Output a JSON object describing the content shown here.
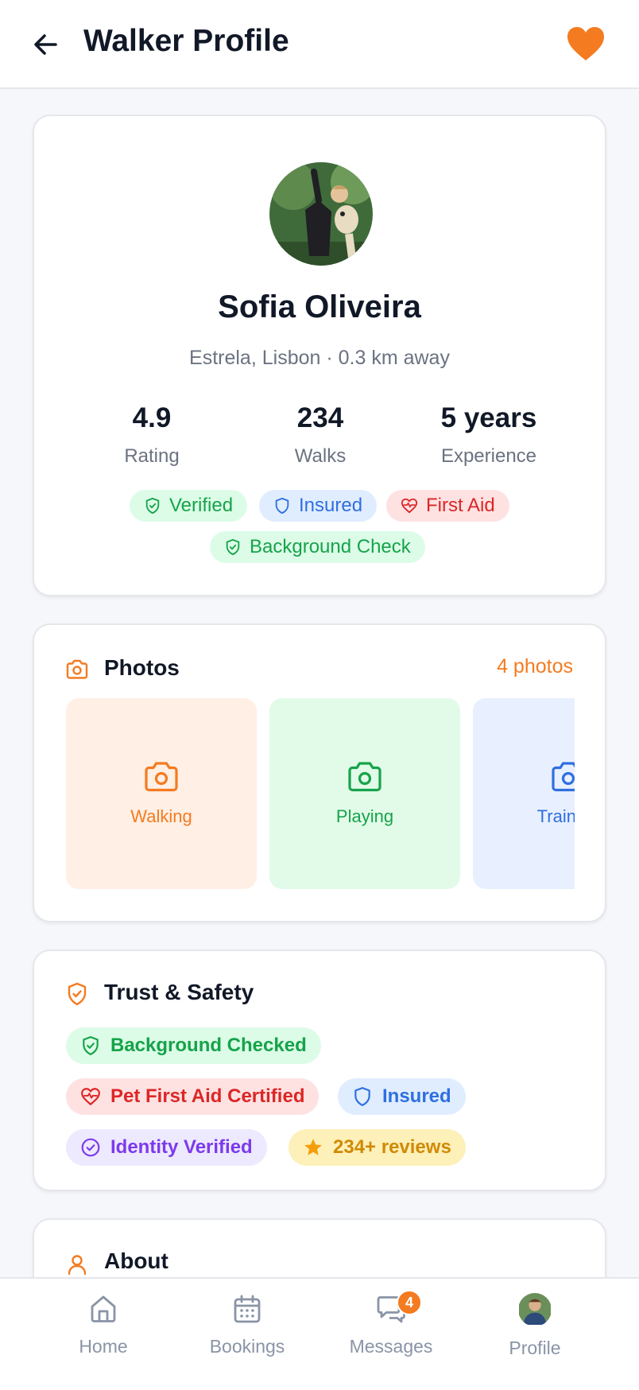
{
  "header": {
    "title": "Walker Profile"
  },
  "profile": {
    "name": "Sofia Oliveira",
    "location": "Estrela, Lisbon · 0.3 km away",
    "stats": [
      {
        "value": "4.9",
        "label": "Rating"
      },
      {
        "value": "234",
        "label": "Walks"
      },
      {
        "value": "5 years",
        "label": "Experience"
      }
    ],
    "badges": [
      "Verified",
      "Insured",
      "First Aid",
      "Background Check"
    ]
  },
  "photos": {
    "title": "Photos",
    "count": "4 photos",
    "items": [
      "Walking",
      "Playing",
      "Training"
    ]
  },
  "trust": {
    "title": "Trust & Safety",
    "badges": [
      "Background Checked",
      "Pet First Aid Certified",
      "Insured",
      "Identity Verified",
      "234+ reviews"
    ]
  },
  "about": {
    "title": "About"
  },
  "nav": {
    "items": [
      "Home",
      "Bookings",
      "Messages",
      "Profile"
    ],
    "messages_badge": "4"
  },
  "colors": {
    "accent": "#f47b20",
    "text": "#111827",
    "muted": "#6b7280",
    "green": "#16a34a",
    "blue": "#2f6fdf",
    "red": "#dc2626",
    "purple": "#7c3aed",
    "yellow": "#d08a05"
  }
}
